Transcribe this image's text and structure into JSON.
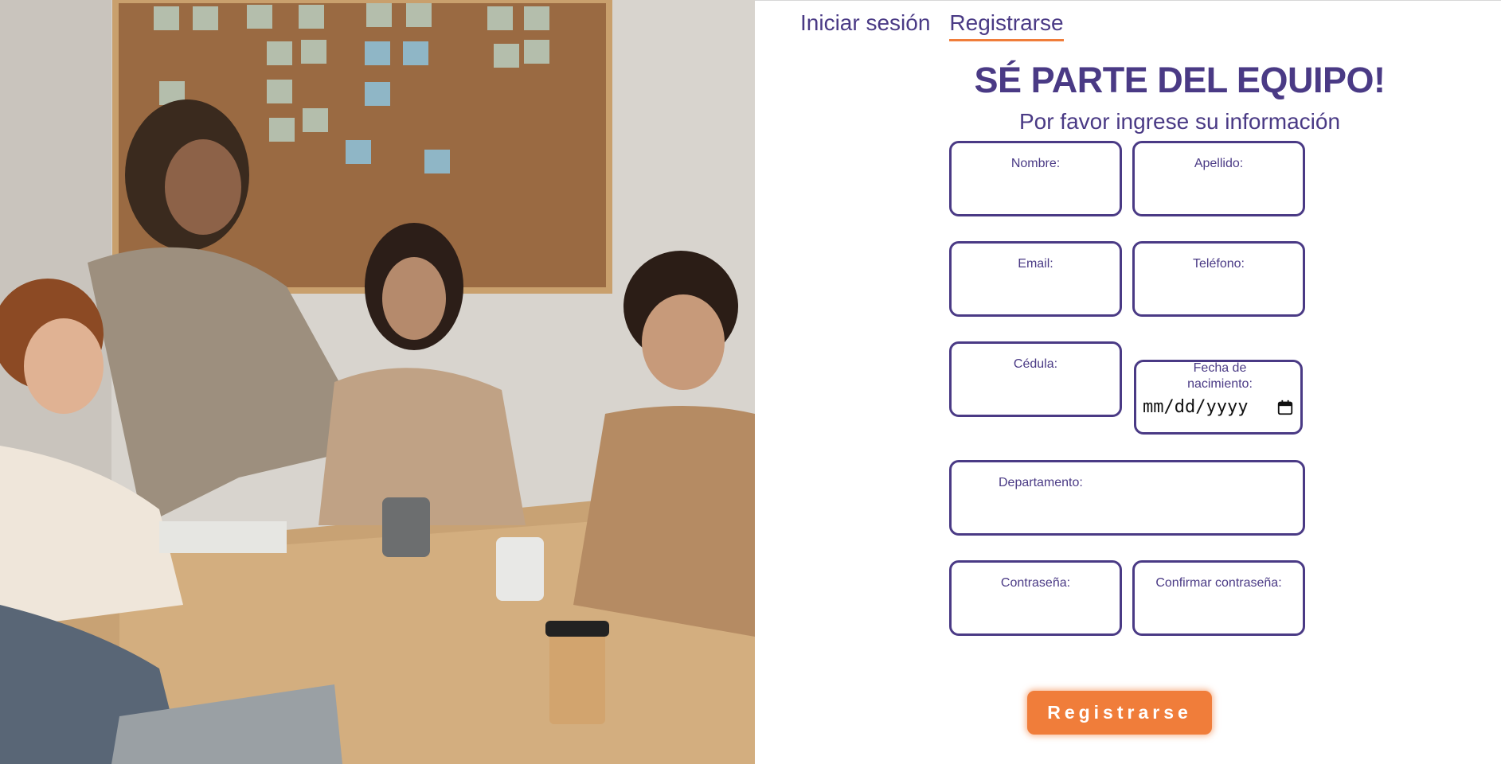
{
  "tabs": [
    {
      "label": "Iniciar sesión",
      "active": false
    },
    {
      "label": "Registrarse",
      "active": true
    }
  ],
  "title": "SÉ PARTE DEL EQUIPO!",
  "subtitle": "Por favor ingrese su información",
  "fields": {
    "nombre": "Nombre:",
    "apellido": "Apellido:",
    "email": "Email:",
    "telefono": "Teléfono:",
    "cedula": "Cédula:",
    "fecha": "Fecha de nacimiento:",
    "fecha_placeholder": "mm/dd/yyyy",
    "departamento": "Departamento:",
    "contrasena": "Contraseña:",
    "confirmar": "Confirmar contraseña:"
  },
  "submit_label": "Registrarse",
  "colors": {
    "brand": "#4a3a85",
    "accent": "#f07d3a"
  },
  "icons": [
    "calendar-icon"
  ],
  "image": "team-meeting-photo"
}
